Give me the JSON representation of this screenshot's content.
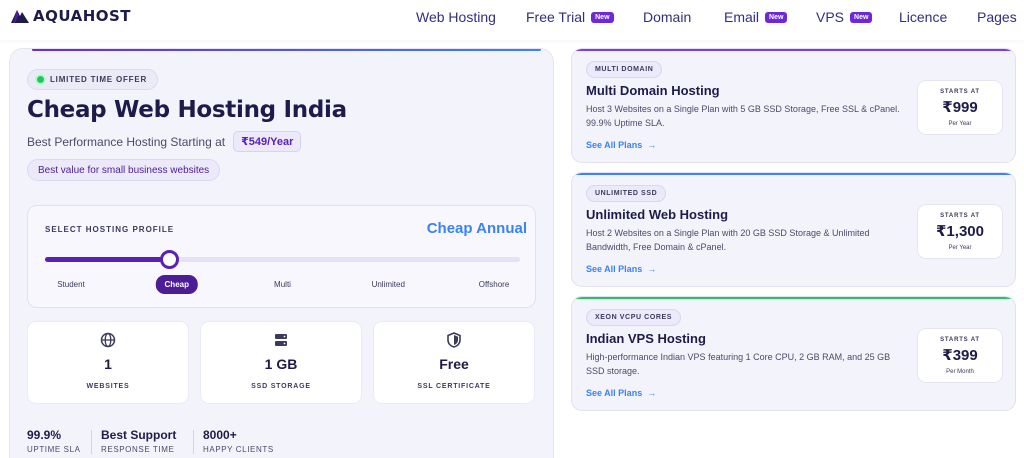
{
  "brand": {
    "name": "AQUAHOST"
  },
  "nav": {
    "items": [
      {
        "label": "Web Hosting"
      },
      {
        "label": "Free Trial",
        "badge": "New"
      },
      {
        "label": "Domain"
      },
      {
        "label": "Email",
        "badge": "New"
      },
      {
        "label": "VPS",
        "badge": "New"
      },
      {
        "label": "Licence"
      },
      {
        "label": "Pages"
      }
    ]
  },
  "hero": {
    "offer_badge": "LIMITED TIME OFFER",
    "title": "Cheap Web Hosting India",
    "subtitle": "Best Performance Hosting Starting at",
    "price_chip": "₹549/Year",
    "value_chip": "Best value for small business websites"
  },
  "selector": {
    "label": "SELECT HOSTING PROFILE",
    "value": "Cheap Annual",
    "position": 0.26,
    "options": [
      {
        "label": "Student"
      },
      {
        "label": "Cheap",
        "active": true
      },
      {
        "label": "Multi"
      },
      {
        "label": "Unlimited"
      },
      {
        "label": "Offshore"
      }
    ]
  },
  "stats": [
    {
      "icon": "globe-icon",
      "value": "1",
      "label": "WEBSITES"
    },
    {
      "icon": "server-icon",
      "value": "1 GB",
      "label": "SSD STORAGE"
    },
    {
      "icon": "shield-icon",
      "value": "Free",
      "label": "SSL CERTIFICATE"
    }
  ],
  "metrics": [
    {
      "value": "99.9%",
      "label": "UPTIME SLA"
    },
    {
      "value": "Best Support",
      "label": "RESPONSE TIME"
    },
    {
      "value": "8000+",
      "label": "HAPPY CLIENTS"
    }
  ],
  "plans": [
    {
      "tag": "MULTI DOMAIN",
      "title": "Multi Domain Hosting",
      "description": "Host 3 Websites on a Single Plan with 5 GB SSD Storage, Free SSL & cPanel. 99.9% Uptime SLA.",
      "link": "See All Plans",
      "starts_label": "STARTS AT",
      "price": "₹999",
      "period": "Per Year",
      "accent": "#7c3aed"
    },
    {
      "tag": "UNLIMITED SSD",
      "title": "Unlimited Web Hosting",
      "description": "Host 2 Websites on a Single Plan with 20 GB SSD Storage & Unlimited Bandwidth, Free Domain & cPanel.",
      "link": "See All Plans",
      "starts_label": "STARTS AT",
      "price": "₹1,300",
      "period": "Per Year",
      "accent": "#3b82f6"
    },
    {
      "tag": "XEON VCPU CORES",
      "title": "Indian VPS Hosting",
      "description": "High-performance Indian VPS featuring 1 Core CPU, 2 GB RAM, and 25 GB SSD storage.",
      "link": "See All Plans",
      "starts_label": "STARTS AT",
      "price": "₹399",
      "period": "Per Month",
      "accent": "#22c55e"
    }
  ],
  "colors": {
    "primary": "#5b21b6",
    "link": "#3b82f6",
    "text": "#1e1b4b"
  }
}
